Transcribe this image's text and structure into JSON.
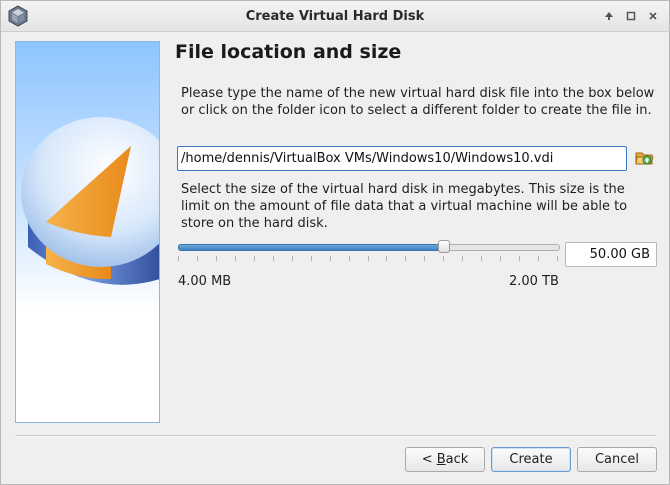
{
  "window": {
    "title": "Create Virtual Hard Disk",
    "controls": [
      "up-arrow-icon",
      "maximize-icon",
      "close-icon"
    ]
  },
  "page": {
    "heading": "File location and size",
    "location_instructions": "Please type the name of the new virtual hard disk file into the box below or click on the folder icon to select a different folder to create the file in.",
    "file_path": "/home/dennis/VirtualBox VMs/Windows10/Windows10.vdi",
    "size_instructions": "Select the size of the virtual hard disk in megabytes. This size is the limit on the amount of file data that a virtual machine will be able to store on the hard disk.",
    "size_value": "50.00 GB",
    "slider_fraction": 0.7,
    "slider_ticks": 20,
    "min_size": "4.00 MB",
    "max_size": "2.00 TB"
  },
  "buttons": {
    "back_prefix": "< ",
    "back_mnemonic": "B",
    "back_rest": "ack",
    "create": "Create",
    "cancel": "Cancel"
  },
  "colors": {
    "accent": "#3f83c3",
    "side_gradient_top": "#8ec5ff",
    "side_gradient_bottom": "#ffffff"
  }
}
